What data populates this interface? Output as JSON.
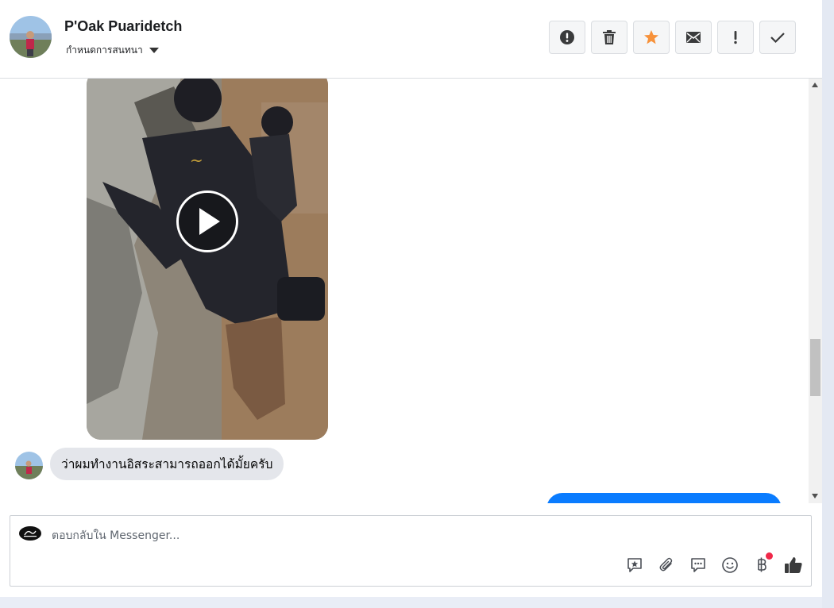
{
  "header": {
    "contact_name": "P'Oak Puaridetch",
    "label_select": "กำหนดการสนทนา",
    "actions": [
      {
        "name": "mark-spam-button",
        "icon": "exclamation-circle-icon"
      },
      {
        "name": "delete-button",
        "icon": "trash-icon"
      },
      {
        "name": "star-button",
        "icon": "star-icon",
        "color": "#f7923b"
      },
      {
        "name": "mark-unread-button",
        "icon": "envelope-icon"
      },
      {
        "name": "follow-up-button",
        "icon": "exclamation-icon"
      },
      {
        "name": "mark-done-button",
        "icon": "checkmark-icon"
      }
    ]
  },
  "conversation": {
    "video_message": {
      "icon": "play-icon"
    },
    "incoming_message": "ว่าผมทำงานอิสระสามารถออกได้มั้ยครับ",
    "outgoing_bubble_color": "#0a7cff"
  },
  "composer": {
    "placeholder": "ตอบกลับใน Messenger...",
    "tools": [
      "saved-reply-icon",
      "attachment-icon",
      "chat-bubble-icon",
      "emoji-icon",
      "baht-payment-icon",
      "thumbs-up-icon"
    ]
  },
  "colors": {
    "accent": "#0a7cff",
    "star": "#f7923b",
    "notification_dot": "#f02849"
  }
}
